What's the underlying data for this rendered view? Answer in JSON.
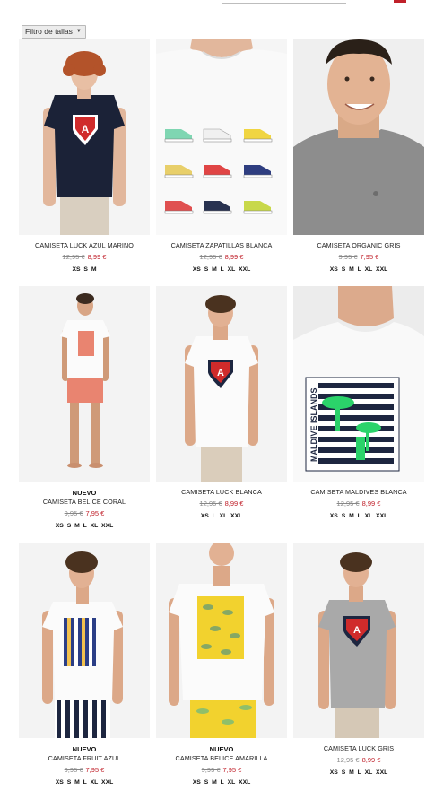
{
  "filter": {
    "label": "Filtro de tallas"
  },
  "products": [
    {
      "badge": "",
      "name": "CAMISETA LUCK AZUL MARINO",
      "old_price": "12,95 €",
      "price": "8,99 €",
      "sizes": "XS S M"
    },
    {
      "badge": "",
      "name": "CAMISETA ZAPATILLAS BLANCA",
      "old_price": "12,95 €",
      "price": "8,99 €",
      "sizes": "XS S M L XL XXL"
    },
    {
      "badge": "",
      "name": "CAMISETA ORGANIC GRIS",
      "old_price": "9,95 €",
      "price": "7,95 €",
      "sizes": "XS S M L XL XXL"
    },
    {
      "badge": "NUEVO",
      "name": "CAMISETA BELICE CORAL",
      "old_price": "9,95 €",
      "price": "7,95 €",
      "sizes": "XS S M L XL XXL"
    },
    {
      "badge": "",
      "name": "CAMISETA LUCK BLANCA",
      "old_price": "12,95 €",
      "price": "8,99 €",
      "sizes": "XS L XL XXL"
    },
    {
      "badge": "",
      "name": "CAMISETA MALDIVES BLANCA",
      "old_price": "12,95 €",
      "price": "8,99 €",
      "sizes": "XS S M L XL XXL"
    },
    {
      "badge": "NUEVO",
      "name": "CAMISETA FRUIT AZUL",
      "old_price": "9,95 €",
      "price": "7,95 €",
      "sizes": "XS S M L XL XXL"
    },
    {
      "badge": "NUEVO",
      "name": "CAMISETA BELICE AMARILLA",
      "old_price": "9,95 €",
      "price": "7,95 €",
      "sizes": "XS S M L XL XXL"
    },
    {
      "badge": "",
      "name": "CAMISETA LUCK GRIS",
      "old_price": "12,95 €",
      "price": "8,99 €",
      "sizes": "XS S M L XL XXL"
    }
  ],
  "print_text": {
    "maldive": "MALDIVE ISLANDS"
  },
  "colors": {
    "sale_red": "#c0202a",
    "navy": "#1d2640",
    "coral": "#e98470",
    "yellow": "#f2d22e"
  }
}
